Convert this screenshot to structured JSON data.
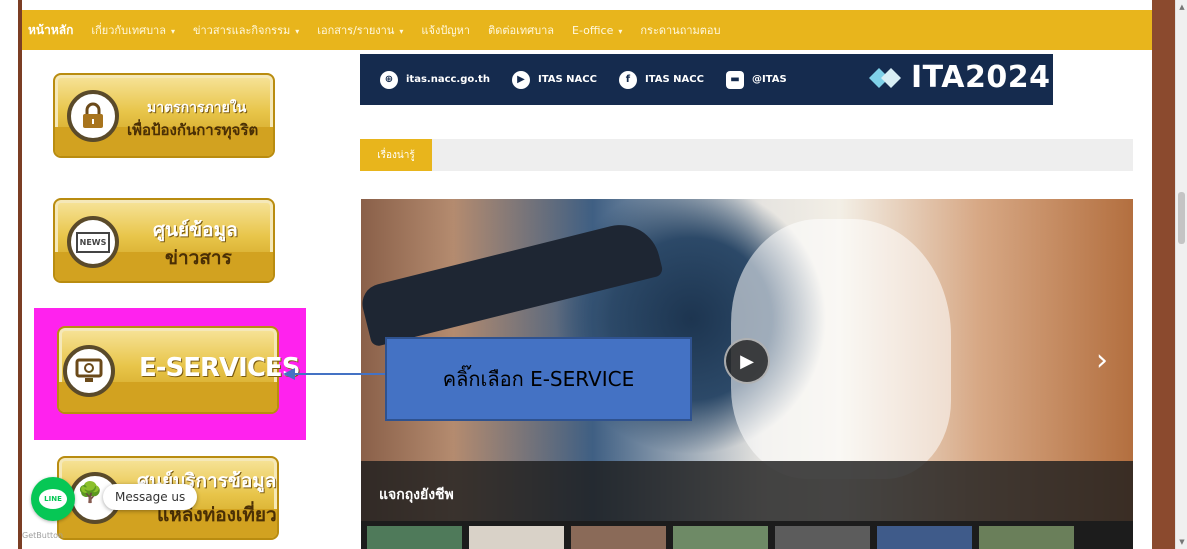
{
  "navbar": {
    "items": [
      {
        "label": "หน้าหลัก",
        "dropdown": false
      },
      {
        "label": "เกี่ยวกับเทศบาล",
        "dropdown": true
      },
      {
        "label": "ข่าวสารและกิจกรรม",
        "dropdown": true
      },
      {
        "label": "เอกสาร/รายงาน",
        "dropdown": true
      },
      {
        "label": "แจ้งปัญหา",
        "dropdown": false
      },
      {
        "label": "ติดต่อเทศบาล",
        "dropdown": false
      },
      {
        "label": "E-office",
        "dropdown": true
      },
      {
        "label": "กระดานถามตอบ",
        "dropdown": false
      }
    ],
    "caret": "▾",
    "background": "#e8b51c"
  },
  "sidebar": {
    "anti_corruption": {
      "line1": "มาตรการภายใน",
      "line2": "เพื่อป้องกันการทุจริต",
      "icon": "lock-icon"
    },
    "news_center": {
      "line1": "ศูนย์ข้อมูล",
      "line2": "ข่าวสาร",
      "icon": "news-icon",
      "icon_text": "NEWS"
    },
    "eservices": {
      "label": "E-SERVICES",
      "icon": "monitor-gear-icon",
      "highlight_color": "#ff22ee"
    },
    "tourism": {
      "line1": "ศูนย์บริการข้อมูล",
      "line2": "แหล่งท่องเที่ยว",
      "icon": "tourism-icon"
    }
  },
  "banner": {
    "website": "itas.nacc.go.th",
    "youtube": "ITAS NACC",
    "facebook": "ITAS NACC",
    "line": "@ITAS",
    "ita_logo": "ITA2024"
  },
  "tabs": {
    "active": "เรื่องน่ารู้"
  },
  "slider": {
    "caption": "แจกถุงยังชีพ",
    "next_glyph": "›",
    "play_glyph": "▶"
  },
  "callout": {
    "text": "คลิ๊กเลือก E-SERVICE",
    "color": "#4472c4"
  },
  "chat_widget": {
    "line_label": "LINE",
    "message_label": "Message us",
    "getbutton_label": "GetButton"
  },
  "colors": {
    "brand_gold": "#e8b51c",
    "banner_navy": "#152b4e",
    "frame_brown": "#8b4a2e"
  }
}
